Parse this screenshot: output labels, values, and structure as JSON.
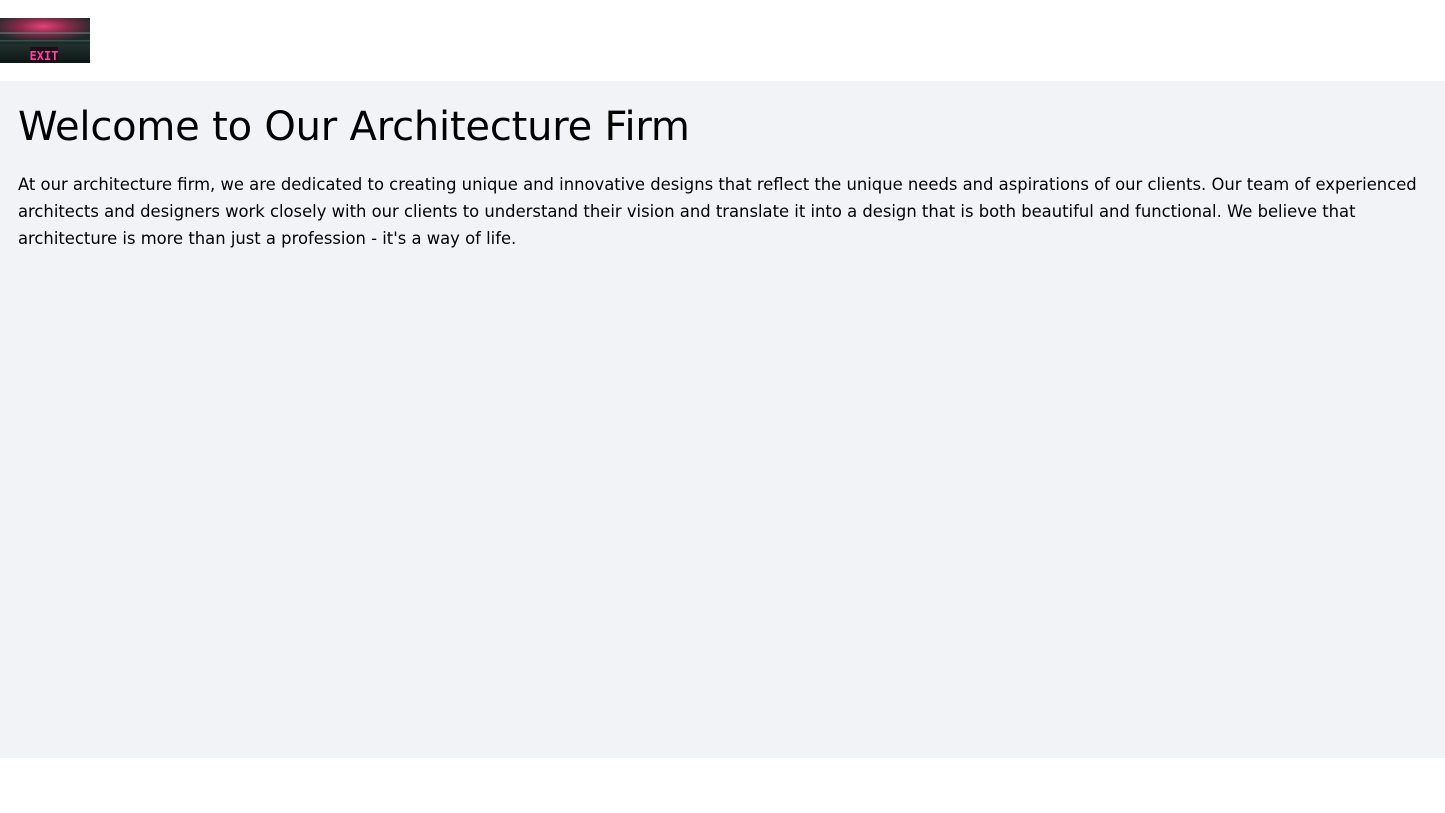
{
  "header": {
    "logo": {
      "icon": "exit-sign-logo",
      "text": "EXIT",
      "colors": {
        "sign_glow": "#d6336c",
        "sign_text": "#ff3fa7",
        "background": "#0f2420"
      }
    }
  },
  "main": {
    "title": "Welcome to Our Architecture Firm",
    "intro": "At our architecture firm, we are dedicated to creating unique and innovative designs that reflect the unique needs and aspirations of our clients. Our team of experienced architects and designers work closely with our clients to understand their vision and translate it into a design that is both beautiful and functional. We believe that architecture is more than just a profession - it's a way of life."
  },
  "colors": {
    "header_background": "#ffffff",
    "main_background": "#f2f3f7",
    "text": "#000000"
  }
}
